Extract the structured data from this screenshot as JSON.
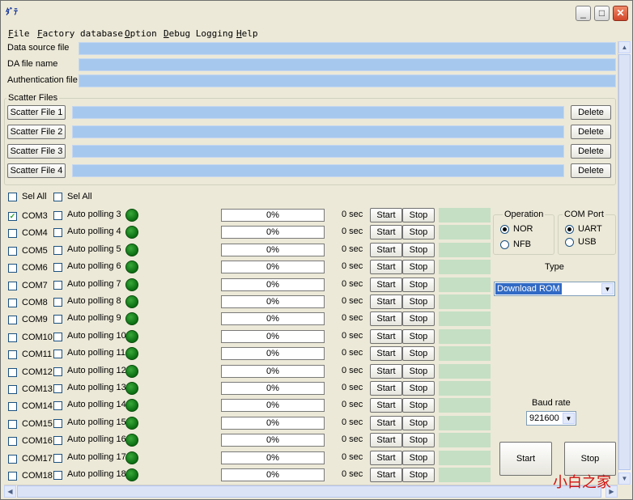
{
  "window": {
    "icon_label": "ﾀﾞﾃ",
    "minimize_glyph": "_",
    "maximize_glyph": "□",
    "close_glyph": "✕"
  },
  "menu": [
    "File",
    "Factory database",
    "Option",
    "Debug Logging",
    "Help"
  ],
  "files": {
    "data_source_label": "Data source file",
    "da_label": "DA file name",
    "auth_label": "Authentication file"
  },
  "scatter": {
    "group_title": "Scatter Files",
    "buttons": [
      "Scatter File 1",
      "Scatter File 2",
      "Scatter File 3",
      "Scatter File 4"
    ],
    "delete_label": "Delete"
  },
  "header": {
    "sel_all_1": "Sel All",
    "sel_all_2": "Sel All"
  },
  "ports": [
    {
      "com": "COM3",
      "polling": "Auto polling 3",
      "progress": "0%",
      "time": "0 sec",
      "checked": true
    },
    {
      "com": "COM4",
      "polling": "Auto polling 4",
      "progress": "0%",
      "time": "0 sec",
      "checked": false
    },
    {
      "com": "COM5",
      "polling": "Auto polling 5",
      "progress": "0%",
      "time": "0 sec",
      "checked": false
    },
    {
      "com": "COM6",
      "polling": "Auto polling 6",
      "progress": "0%",
      "time": "0 sec",
      "checked": false
    },
    {
      "com": "COM7",
      "polling": "Auto polling 7",
      "progress": "0%",
      "time": "0 sec",
      "checked": false
    },
    {
      "com": "COM8",
      "polling": "Auto polling 8",
      "progress": "0%",
      "time": "0 sec",
      "checked": false
    },
    {
      "com": "COM9",
      "polling": "Auto polling 9",
      "progress": "0%",
      "time": "0 sec",
      "checked": false
    },
    {
      "com": "COM10",
      "polling": "Auto polling 10",
      "progress": "0%",
      "time": "0 sec",
      "checked": false
    },
    {
      "com": "COM11",
      "polling": "Auto polling 11",
      "progress": "0%",
      "time": "0 sec",
      "checked": false
    },
    {
      "com": "COM12",
      "polling": "Auto polling 12",
      "progress": "0%",
      "time": "0 sec",
      "checked": false
    },
    {
      "com": "COM13",
      "polling": "Auto polling 13",
      "progress": "0%",
      "time": "0 sec",
      "checked": false
    },
    {
      "com": "COM14",
      "polling": "Auto polling 14",
      "progress": "0%",
      "time": "0 sec",
      "checked": false
    },
    {
      "com": "COM15",
      "polling": "Auto polling 15",
      "progress": "0%",
      "time": "0 sec",
      "checked": false
    },
    {
      "com": "COM16",
      "polling": "Auto polling 16",
      "progress": "0%",
      "time": "0 sec",
      "checked": false
    },
    {
      "com": "COM17",
      "polling": "Auto polling 17",
      "progress": "0%",
      "time": "0 sec",
      "checked": false
    },
    {
      "com": "COM18",
      "polling": "Auto polling 18",
      "progress": "0%",
      "time": "0 sec",
      "checked": false
    }
  ],
  "row_buttons": {
    "start": "Start",
    "stop": "Stop"
  },
  "operation": {
    "title": "Operation",
    "options": [
      "NOR",
      "NFB"
    ],
    "selected": "NOR"
  },
  "com_port": {
    "title": "COM Port",
    "options": [
      "UART",
      "USB"
    ],
    "selected": "UART"
  },
  "type": {
    "label": "Type",
    "value": "Download ROM"
  },
  "baud": {
    "label": "Baud rate",
    "value": "921600"
  },
  "main_buttons": {
    "start": "Start",
    "stop": "Stop"
  },
  "watermark": "小白之家",
  "colors": {
    "field_blue": "#a7c8ee",
    "status_green": "#c4dfc4",
    "led_green": "#0b6e12",
    "face": "#ece9d8"
  }
}
